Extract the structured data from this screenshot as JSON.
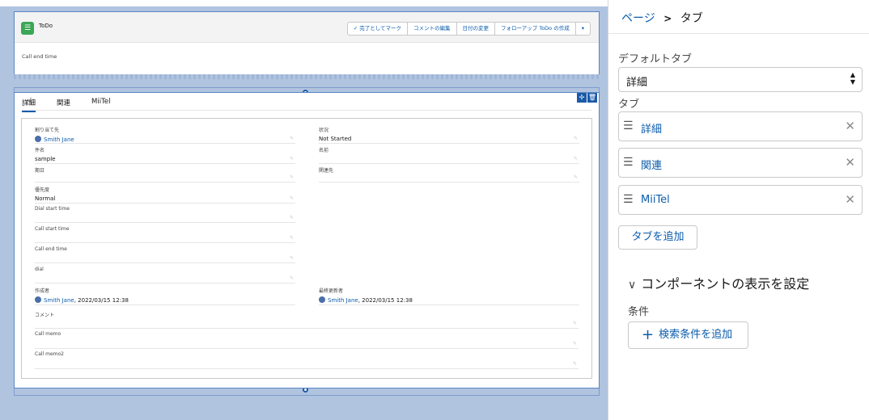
{
  "record": {
    "title": "ToDo",
    "buttons": [
      "✓ 完了としてマーク",
      "コメントの編集",
      "日付の変更",
      "フォローアップ ToDo の作成",
      "▾"
    ],
    "highlight_field_label": "Call end time"
  },
  "tabs": [
    "詳細",
    "関連",
    "MiiTel"
  ],
  "fields": {
    "assignee": {
      "label": "割り当て先",
      "value": "Smith Jane"
    },
    "status": {
      "label": "状況",
      "value": "Not Started"
    },
    "subject": {
      "label": "件名",
      "value": "sample"
    },
    "name": {
      "label": "名前",
      "value": ""
    },
    "due": {
      "label": "期日",
      "value": ""
    },
    "related": {
      "label": "関連先",
      "value": ""
    },
    "priority": {
      "label": "優先度",
      "value": "Normal"
    },
    "dial_start": {
      "label": "Dial start time",
      "value": ""
    },
    "call_start": {
      "label": "Call start time",
      "value": ""
    },
    "call_end": {
      "label": "Call end time",
      "value": ""
    },
    "dial": {
      "label": "dial",
      "value": ""
    },
    "created_by": {
      "label": "作成者",
      "user": "Smith Jane",
      "date": ", 2022/03/15 12:38"
    },
    "modified_by": {
      "label": "最終更新者",
      "user": "Smith Jane",
      "date": ", 2022/03/15 12:38"
    },
    "comment": {
      "label": "コメント",
      "value": ""
    },
    "call_memo": {
      "label": "Call memo",
      "value": ""
    },
    "call_memo2": {
      "label": "Call memo2",
      "value": ""
    }
  },
  "panel": {
    "crumb_link": "ページ",
    "crumb_sep": ">",
    "crumb_current": "タブ",
    "default_tab_label": "デフォルトタブ",
    "default_tab_value": "詳細",
    "tabs_label": "タブ",
    "tab_items": [
      "詳細",
      "関連",
      "MiiTel"
    ],
    "add_tab": "タブを追加",
    "visibility_section": "コンポーネントの表示を設定",
    "condition_label": "条件",
    "add_condition": "検索条件を追加"
  },
  "colors": {
    "brand": "#0b5cab",
    "canvas": "#b0c4df",
    "todo_icon": "#3ba755"
  }
}
